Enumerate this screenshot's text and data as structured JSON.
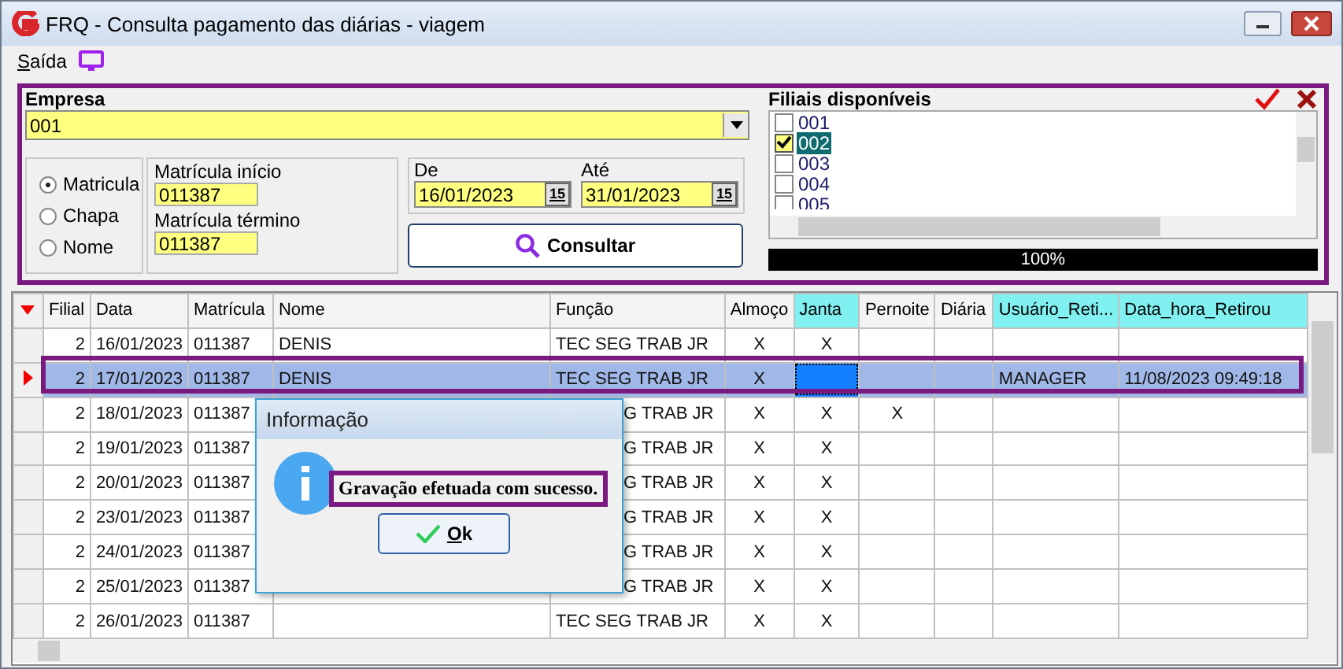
{
  "window": {
    "title": "FRQ - Consulta pagamento das diárias - viagem"
  },
  "menu": [
    {
      "label": "Saída"
    }
  ],
  "filter": {
    "empresa_label": "Empresa",
    "empresa_value": "001",
    "search_by": [
      {
        "label": "Matricula",
        "selected": true
      },
      {
        "label": "Chapa",
        "selected": false
      },
      {
        "label": "Nome",
        "selected": false
      }
    ],
    "matricula_inicio_label": "Matrícula início",
    "matricula_inicio": "011387",
    "matricula_termino_label": "Matrícula término",
    "matricula_termino": "011387",
    "de_label": "De",
    "de": "16/01/2023",
    "ate_label": "Até",
    "ate": "31/01/2023",
    "de_calendar_key": "15",
    "ate_calendar_key": "15",
    "consultar": "Consultar"
  },
  "branches": {
    "title": "Filiais disponíveis",
    "items": [
      {
        "label": "001",
        "checked": false,
        "selected": false
      },
      {
        "label": "002",
        "checked": true,
        "selected": true
      },
      {
        "label": "003",
        "checked": false,
        "selected": false
      },
      {
        "label": "004",
        "checked": false,
        "selected": false
      },
      {
        "label": "005",
        "checked": false,
        "selected": false
      }
    ],
    "progress": {
      "level": 1,
      "label": "100%"
    }
  },
  "grid": {
    "columns": [
      {
        "label": "Filial",
        "highlighted": false,
        "focused": false
      },
      {
        "label": "Data",
        "highlighted": false,
        "focused": false
      },
      {
        "label": "Matrícula",
        "highlighted": false,
        "focused": false
      },
      {
        "label": "Nome",
        "highlighted": false,
        "focused": false
      },
      {
        "label": "Função",
        "highlighted": false,
        "focused": false
      },
      {
        "label": "Almoço",
        "highlighted": false,
        "focused": false
      },
      {
        "label": "Janta",
        "highlighted": true,
        "focused": true
      },
      {
        "label": "Pernoite",
        "highlighted": false,
        "focused": false
      },
      {
        "label": "Diária",
        "highlighted": false,
        "focused": false
      },
      {
        "label": "Usuário_Reti...",
        "highlighted": true,
        "focused": false
      },
      {
        "label": "Data_hora_Retirou",
        "highlighted": true,
        "focused": false
      }
    ],
    "rows": [
      {
        "selected": false,
        "covered": false,
        "cells": [
          "2",
          "16/01/2023",
          "011387",
          "DENIS",
          "TEC SEG TRAB JR",
          "X",
          "X",
          null,
          null,
          null,
          null
        ]
      },
      {
        "selected": true,
        "covered": false,
        "cells": [
          "2",
          "17/01/2023",
          "011387",
          "DENIS",
          "TEC SEG TRAB JR",
          "X",
          null,
          null,
          null,
          "MANAGER",
          "11/08/2023 09:49:18"
        ]
      },
      {
        "selected": false,
        "covered": true,
        "cells": [
          "2",
          "18/01/2023",
          "011387",
          null,
          "G TRAB JR",
          "X",
          "X",
          "X",
          null,
          null,
          null
        ]
      },
      {
        "selected": false,
        "covered": true,
        "cells": [
          "2",
          "19/01/2023",
          "011387",
          null,
          "G TRAB JR",
          "X",
          "X",
          null,
          null,
          null,
          null
        ]
      },
      {
        "selected": false,
        "covered": true,
        "cells": [
          "2",
          "20/01/2023",
          "011387",
          null,
          "G TRAB JR",
          "X",
          "X",
          null,
          null,
          null,
          null
        ]
      },
      {
        "selected": false,
        "covered": true,
        "cells": [
          "2",
          "23/01/2023",
          "011387",
          null,
          "G TRAB JR",
          "X",
          "X",
          null,
          null,
          null,
          null
        ]
      },
      {
        "selected": false,
        "covered": true,
        "cells": [
          "2",
          "24/01/2023",
          "011387",
          null,
          "G TRAB JR",
          "X",
          "X",
          null,
          null,
          null,
          null
        ]
      },
      {
        "selected": false,
        "covered": true,
        "cells": [
          "2",
          "25/01/2023",
          "011387",
          null,
          "G TRAB JR",
          "X",
          "X",
          null,
          null,
          null,
          null
        ]
      },
      {
        "selected": false,
        "covered": false,
        "cells": [
          "2",
          "26/01/2023",
          "011387",
          null,
          "TEC SEG TRAB JR",
          "X",
          "X",
          null,
          null,
          null,
          null
        ]
      }
    ]
  },
  "dialog": {
    "title": "Informação",
    "message": "Gravação efetuada com sucesso.",
    "ok": "Ok"
  }
}
